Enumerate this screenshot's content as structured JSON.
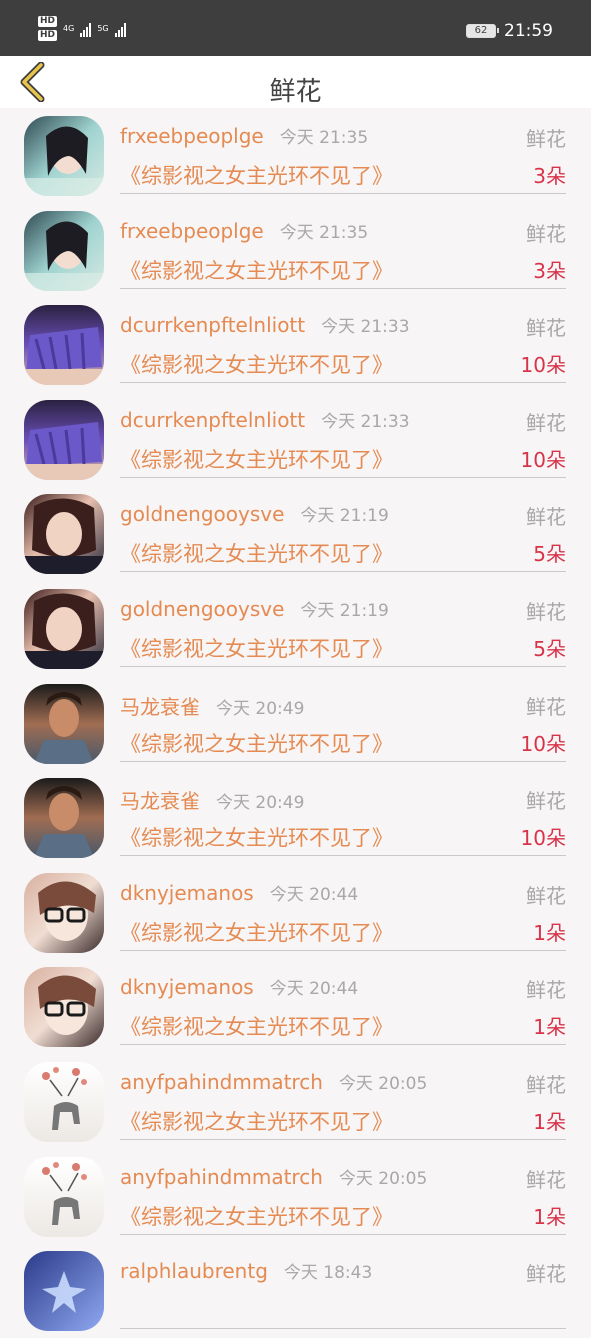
{
  "status_bar": {
    "hd_1": "HD",
    "hd_2": "HD",
    "net_1": "4G",
    "net_2": "5G",
    "battery": "62",
    "time": "21:59"
  },
  "nav": {
    "title": "鲜花",
    "back_icon": "chevron-left-icon",
    "accent": "#e8c44a"
  },
  "colors": {
    "name": "#e58a52",
    "count": "#d9334a",
    "muted": "#a8a8a8"
  },
  "items": [
    {
      "name": "frxeebpeoplge",
      "time": "今天 21:35",
      "type": "鲜花",
      "book": "《综影视之女主光环不见了》",
      "count": "3朵",
      "avatar": "avatar-a"
    },
    {
      "name": "frxeebpeoplge",
      "time": "今天 21:35",
      "type": "鲜花",
      "book": "《综影视之女主光环不见了》",
      "count": "3朵",
      "avatar": "avatar-a"
    },
    {
      "name": "dcurrkenpftelnliott",
      "time": "今天 21:33",
      "type": "鲜花",
      "book": "《综影视之女主光环不见了》",
      "count": "10朵",
      "avatar": "avatar-b"
    },
    {
      "name": "dcurrkenpftelnliott",
      "time": "今天 21:33",
      "type": "鲜花",
      "book": "《综影视之女主光环不见了》",
      "count": "10朵",
      "avatar": "avatar-b"
    },
    {
      "name": "goldnengooysve",
      "time": "今天 21:19",
      "type": "鲜花",
      "book": "《综影视之女主光环不见了》",
      "count": "5朵",
      "avatar": "avatar-c"
    },
    {
      "name": "goldnengooysve",
      "time": "今天 21:19",
      "type": "鲜花",
      "book": "《综影视之女主光环不见了》",
      "count": "5朵",
      "avatar": "avatar-c"
    },
    {
      "name": "马龙衰雀",
      "time": "今天 20:49",
      "type": "鲜花",
      "book": "《综影视之女主光环不见了》",
      "count": "10朵",
      "avatar": "avatar-d"
    },
    {
      "name": "马龙衰雀",
      "time": "今天 20:49",
      "type": "鲜花",
      "book": "《综影视之女主光环不见了》",
      "count": "10朵",
      "avatar": "avatar-d"
    },
    {
      "name": "dknyjemanos",
      "time": "今天 20:44",
      "type": "鲜花",
      "book": "《综影视之女主光环不见了》",
      "count": "1朵",
      "avatar": "avatar-e"
    },
    {
      "name": "dknyjemanos",
      "time": "今天 20:44",
      "type": "鲜花",
      "book": "《综影视之女主光环不见了》",
      "count": "1朵",
      "avatar": "avatar-e"
    },
    {
      "name": "anyfpahindmmatrch",
      "time": "今天 20:05",
      "type": "鲜花",
      "book": "《综影视之女主光环不见了》",
      "count": "1朵",
      "avatar": "avatar-f"
    },
    {
      "name": "anyfpahindmmatrch",
      "time": "今天 20:05",
      "type": "鲜花",
      "book": "《综影视之女主光环不见了》",
      "count": "1朵",
      "avatar": "avatar-f"
    },
    {
      "name": "ralphlaubrentg",
      "time": "今天 18:43",
      "type": "鲜花",
      "book": "",
      "count": "",
      "avatar": "avatar-g"
    }
  ]
}
